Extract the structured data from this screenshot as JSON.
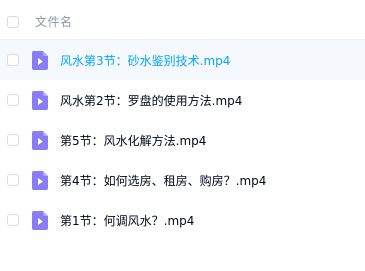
{
  "file_list": {
    "header": {
      "column_name_label": "文件名"
    },
    "rows": [
      {
        "name": "风水第3节：砂水鉴别技术.mp4",
        "icon": "video-file-icon",
        "hovered": true
      },
      {
        "name": "风水第2节：罗盘的使用方法.mp4",
        "icon": "video-file-icon",
        "hovered": false
      },
      {
        "name": "第5节：风水化解方法.mp4",
        "icon": "video-file-icon",
        "hovered": false
      },
      {
        "name": "第4节：如何选房、租房、购房？.mp4",
        "icon": "video-file-icon",
        "hovered": false
      },
      {
        "name": "第1节：何调风水？.mp4",
        "icon": "video-file-icon",
        "hovered": false
      }
    ]
  },
  "colors": {
    "icon_fill": "#8a7cf5",
    "hover_text": "#06a7ff",
    "hover_background": "#f5f8fd",
    "text": "#03081a",
    "header_text": "#9097a3"
  }
}
